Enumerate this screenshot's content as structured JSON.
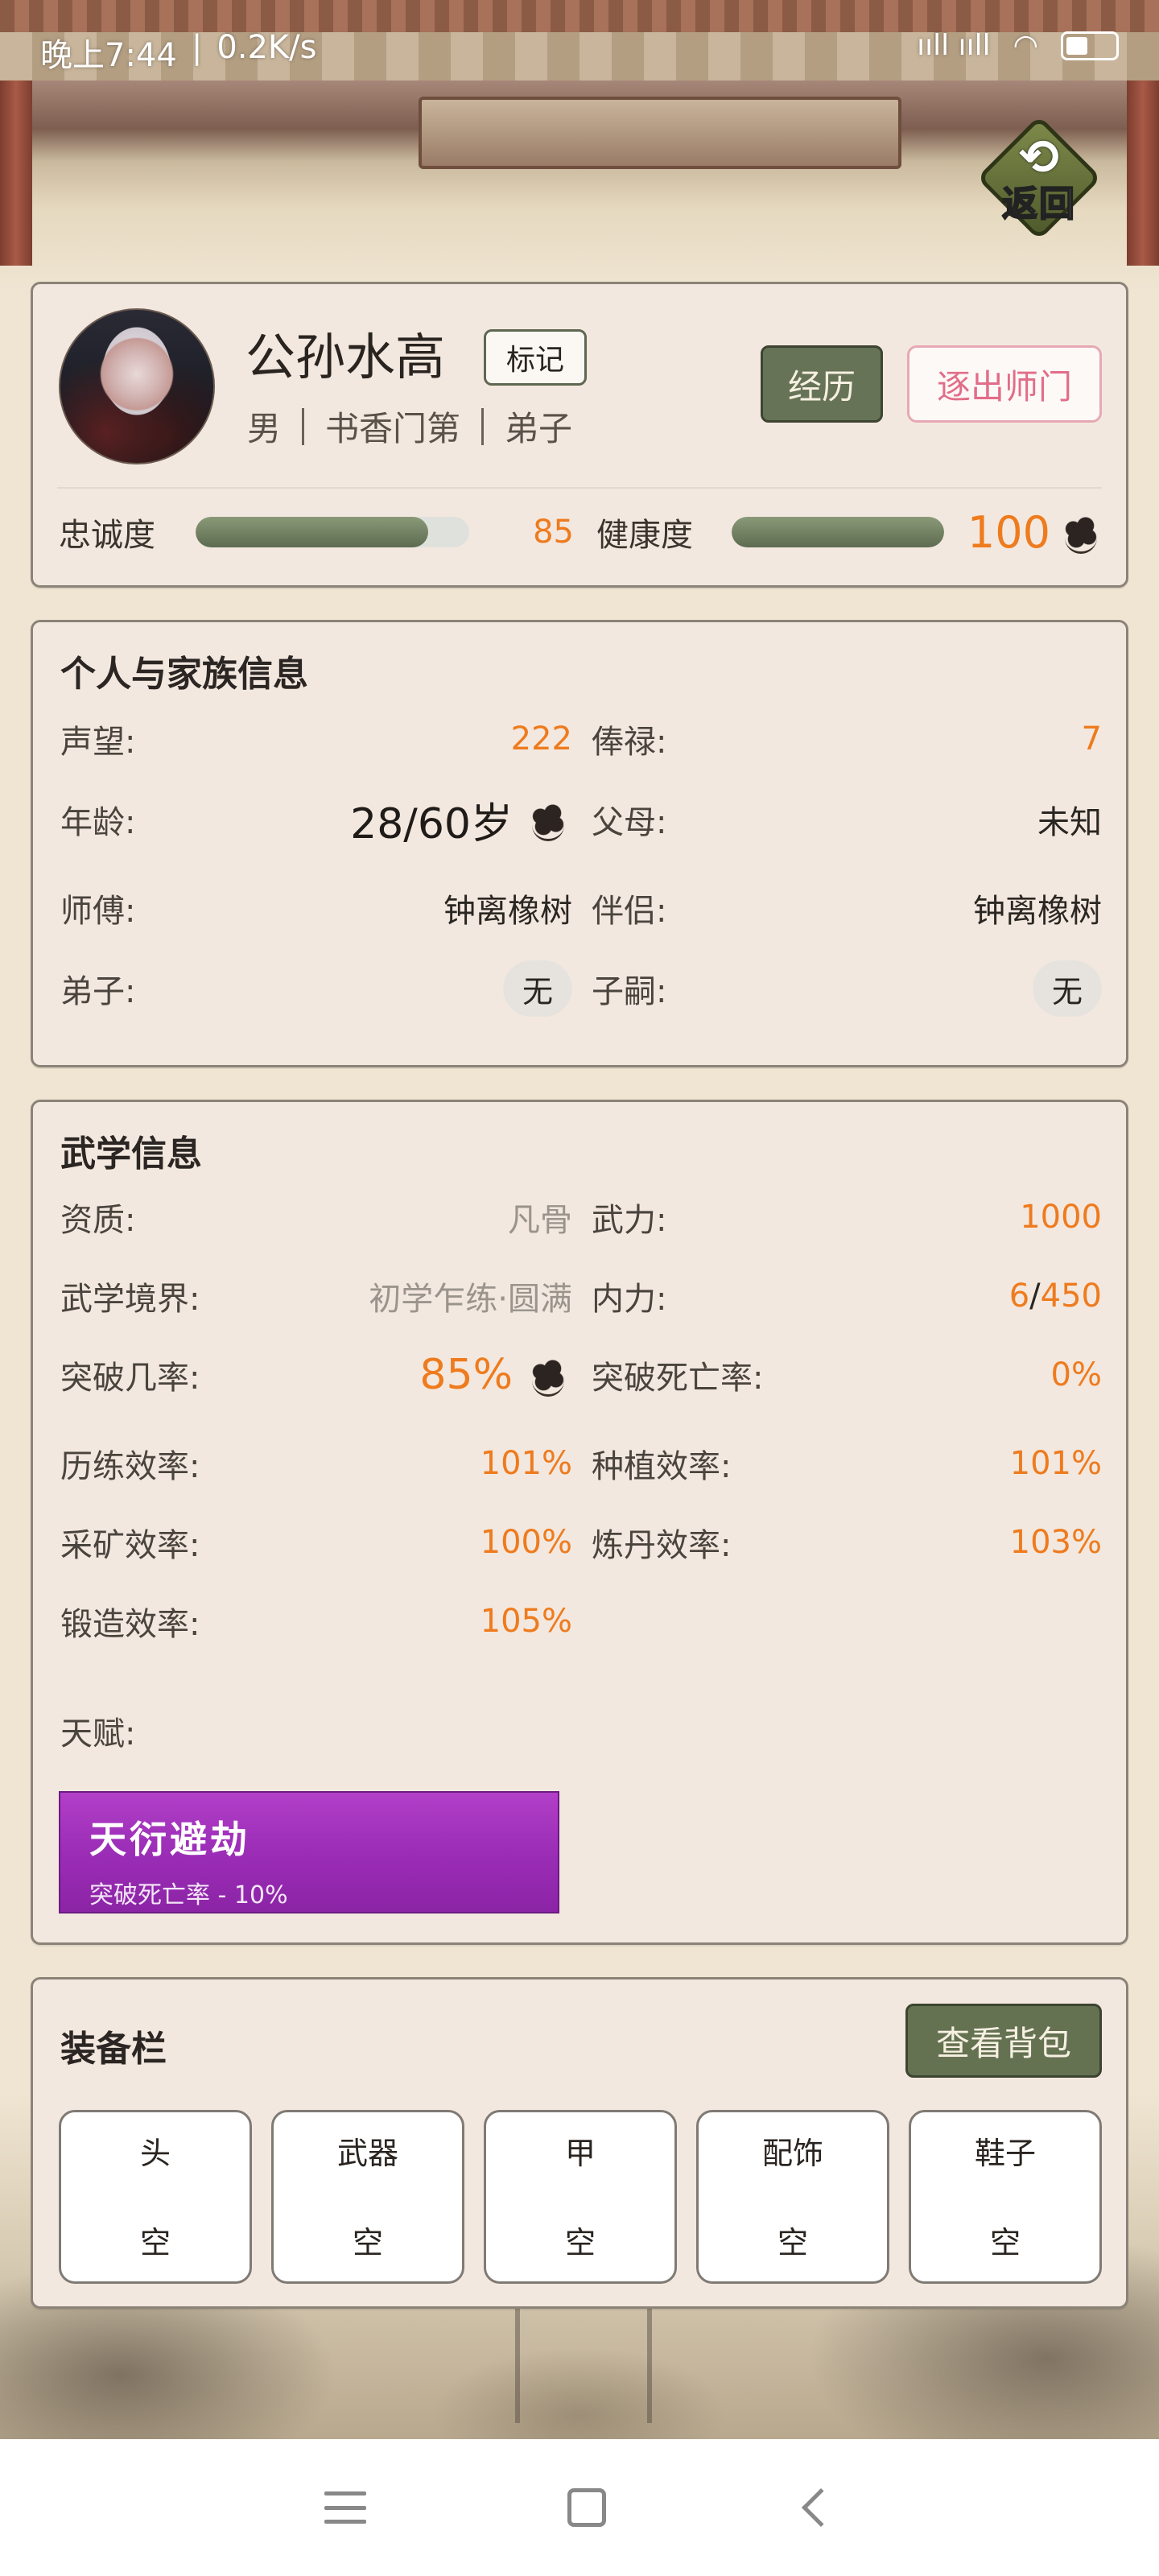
{
  "status_bar": {
    "time": "晚上7:44",
    "speed": "0.2K/s",
    "signal": "ııll ııll"
  },
  "back_button": {
    "label": "返回",
    "arrow": "⟲"
  },
  "profile": {
    "name": "公孙水高",
    "tag_label": "标记",
    "gender": "男",
    "family": "书香门第",
    "role": "弟子",
    "experience_label": "经历",
    "expel_label": "逐出师门",
    "loyalty": {
      "label": "忠诚度",
      "value": "85",
      "percent": 85
    },
    "health": {
      "label": "健康度",
      "value": "100",
      "percent": 100
    }
  },
  "personal": {
    "title": "个人与家族信息",
    "rows": [
      {
        "l_label": "声望:",
        "l_value": "222",
        "r_label": "俸禄:",
        "r_value": "7"
      },
      {
        "l_label": "年龄:",
        "l_value": "28/60岁",
        "r_label": "父母:",
        "r_value": "未知"
      },
      {
        "l_label": "师傅:",
        "l_value": "钟离橡树",
        "r_label": "伴侣:",
        "r_value": "钟离橡树"
      },
      {
        "l_label": "弟子:",
        "l_value": "无",
        "r_label": "子嗣:",
        "r_value": "无"
      }
    ]
  },
  "martial": {
    "title": "武学信息",
    "aptitude": {
      "label": "资质:",
      "value": "凡骨"
    },
    "force": {
      "label": "武力:",
      "value": "1000"
    },
    "realm": {
      "label": "武学境界:",
      "value": "初学乍练·圆满"
    },
    "inner": {
      "label": "内力:",
      "current": "6",
      "sep": "/",
      "max": "450"
    },
    "breakthrough": {
      "label": "突破几率:",
      "value": "85%"
    },
    "breakthrough_death": {
      "label": "突破死亡率:",
      "value": "0%"
    },
    "training": {
      "label": "历练效率:",
      "value": "101%"
    },
    "planting": {
      "label": "种植效率:",
      "value": "101%"
    },
    "mining": {
      "label": "采矿效率:",
      "value": "100%"
    },
    "alchemy": {
      "label": "炼丹效率:",
      "value": "103%"
    },
    "forging": {
      "label": "锻造效率:",
      "value": "105%"
    },
    "talent_label": "天赋:",
    "talent": {
      "name": "天衍避劫",
      "desc": "突破死亡率 - 10%"
    }
  },
  "equipment": {
    "title": "装备栏",
    "bag_label": "查看背包",
    "slots": [
      {
        "name": "头",
        "value": "空"
      },
      {
        "name": "武器",
        "value": "空"
      },
      {
        "name": "甲",
        "value": "空"
      },
      {
        "name": "配饰",
        "value": "空"
      },
      {
        "name": "鞋子",
        "value": "空"
      }
    ]
  },
  "colors": {
    "accent_orange": "#ee7b1e",
    "button_green": "#677356",
    "expel_pink": "#e26d88",
    "talent_purple": "#9b2db6"
  }
}
